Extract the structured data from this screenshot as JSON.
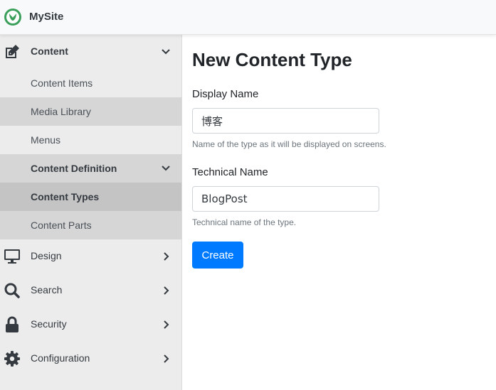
{
  "app": {
    "brand": "MySite"
  },
  "sidebar": {
    "content": {
      "label": "Content",
      "items": [
        {
          "label": "Content Items"
        },
        {
          "label": "Media Library"
        },
        {
          "label": "Menus"
        },
        {
          "label": "Content Definition"
        },
        {
          "label": "Content Types"
        },
        {
          "label": "Content Parts"
        }
      ]
    },
    "design": {
      "label": "Design"
    },
    "search": {
      "label": "Search"
    },
    "security": {
      "label": "Security"
    },
    "configuration": {
      "label": "Configuration"
    }
  },
  "page": {
    "title": "New Content Type",
    "display_name": {
      "label": "Display Name",
      "value": "博客",
      "help": "Name of the type as it will be displayed on screens."
    },
    "technical_name": {
      "label": "Technical Name",
      "value": "BlogPost",
      "help": "Technical name of the type."
    },
    "create_label": "Create"
  },
  "icons": {
    "logo": "leaf-logo-icon",
    "content": "edit-icon",
    "design": "monitor-icon",
    "search": "search-icon",
    "security": "lock-icon",
    "configuration": "gear-icon"
  },
  "colors": {
    "primary": "#007bff",
    "logo": "#3a9f5a",
    "sidebar_bg": "#ececec"
  }
}
